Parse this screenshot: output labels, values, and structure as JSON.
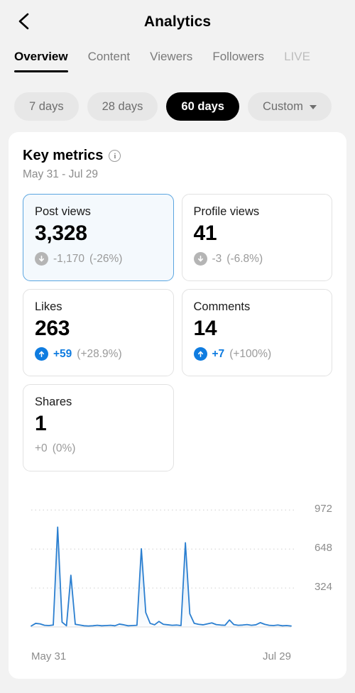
{
  "header": {
    "title": "Analytics",
    "back_icon": "chevron-left-icon"
  },
  "tabs": [
    {
      "label": "Overview",
      "active": true
    },
    {
      "label": "Content",
      "active": false
    },
    {
      "label": "Viewers",
      "active": false
    },
    {
      "label": "Followers",
      "active": false
    },
    {
      "label": "LIVE",
      "active": false
    }
  ],
  "ranges": [
    {
      "label": "7 days",
      "active": false,
      "caret": false
    },
    {
      "label": "28 days",
      "active": false,
      "caret": false
    },
    {
      "label": "60 days",
      "active": true,
      "caret": false
    },
    {
      "label": "Custom",
      "active": false,
      "caret": true
    }
  ],
  "key_metrics": {
    "title": "Key metrics",
    "info_glyph": "i",
    "date_range": "May 31 - Jul 29",
    "cards": [
      {
        "label": "Post views",
        "value": "3,328",
        "delta": "-1,170",
        "pct": "(-26%)",
        "direction": "down",
        "selected": true,
        "has_badge": true
      },
      {
        "label": "Profile views",
        "value": "41",
        "delta": "-3",
        "pct": "(-6.8%)",
        "direction": "down",
        "selected": false,
        "has_badge": true
      },
      {
        "label": "Likes",
        "value": "263",
        "delta": "+59",
        "pct": "(+28.9%)",
        "direction": "up",
        "selected": false,
        "has_badge": true
      },
      {
        "label": "Comments",
        "value": "14",
        "delta": "+7",
        "pct": "(+100%)",
        "direction": "up",
        "selected": false,
        "has_badge": true
      },
      {
        "label": "Shares",
        "value": "1",
        "delta": "+0",
        "pct": "(0%)",
        "direction": "flat",
        "selected": false,
        "has_badge": false
      }
    ]
  },
  "colors": {
    "accent_blue": "#0f7ce0",
    "line_blue": "#2b7fd0",
    "selected_border": "#5aa5e0",
    "selected_bg": "#f4f9fd",
    "muted_text": "#8c8c8c"
  },
  "chart_data": {
    "type": "line",
    "title": "",
    "xlabel": "",
    "ylabel": "",
    "metric": "Post views",
    "grid": true,
    "legend": false,
    "x_tick_labels": [
      "May 31",
      "Jul 29"
    ],
    "y_tick_labels": [
      "324",
      "648",
      "972"
    ],
    "y_ticks": [
      324,
      648,
      972
    ],
    "ylim": [
      0,
      1080
    ],
    "x": [
      "May 31",
      "Jun 1",
      "Jun 2",
      "Jun 3",
      "Jun 4",
      "Jun 5",
      "Jun 6",
      "Jun 7",
      "Jun 8",
      "Jun 9",
      "Jun 10",
      "Jun 11",
      "Jun 12",
      "Jun 13",
      "Jun 14",
      "Jun 15",
      "Jun 16",
      "Jun 17",
      "Jun 18",
      "Jun 19",
      "Jun 20",
      "Jun 21",
      "Jun 22",
      "Jun 23",
      "Jun 24",
      "Jun 25",
      "Jun 26",
      "Jun 27",
      "Jun 28",
      "Jun 29",
      "Jun 30",
      "Jul 1",
      "Jul 2",
      "Jul 3",
      "Jul 4",
      "Jul 5",
      "Jul 6",
      "Jul 7",
      "Jul 8",
      "Jul 9",
      "Jul 10",
      "Jul 11",
      "Jul 12",
      "Jul 13",
      "Jul 14",
      "Jul 15",
      "Jul 16",
      "Jul 17",
      "Jul 18",
      "Jul 19",
      "Jul 20",
      "Jul 21",
      "Jul 22",
      "Jul 23",
      "Jul 24",
      "Jul 25",
      "Jul 26",
      "Jul 27",
      "Jul 28",
      "Jul 29"
    ],
    "values": [
      8,
      30,
      26,
      14,
      12,
      16,
      830,
      40,
      10,
      430,
      22,
      16,
      10,
      8,
      10,
      14,
      10,
      12,
      14,
      10,
      24,
      18,
      10,
      12,
      14,
      650,
      120,
      30,
      18,
      46,
      22,
      18,
      14,
      16,
      12,
      700,
      110,
      30,
      22,
      18,
      26,
      34,
      20,
      16,
      14,
      58,
      20,
      14,
      16,
      20,
      14,
      18,
      36,
      22,
      14,
      12,
      16,
      10,
      12,
      8
    ],
    "series": [
      {
        "name": "Post views",
        "color": "#2b7fd0",
        "values": [
          8,
          30,
          26,
          14,
          12,
          16,
          830,
          40,
          10,
          430,
          22,
          16,
          10,
          8,
          10,
          14,
          10,
          12,
          14,
          10,
          24,
          18,
          10,
          12,
          14,
          650,
          120,
          30,
          18,
          46,
          22,
          18,
          14,
          16,
          12,
          700,
          110,
          30,
          22,
          18,
          26,
          34,
          20,
          16,
          14,
          58,
          20,
          14,
          16,
          20,
          14,
          18,
          36,
          22,
          14,
          12,
          16,
          10,
          12,
          8
        ]
      }
    ]
  }
}
